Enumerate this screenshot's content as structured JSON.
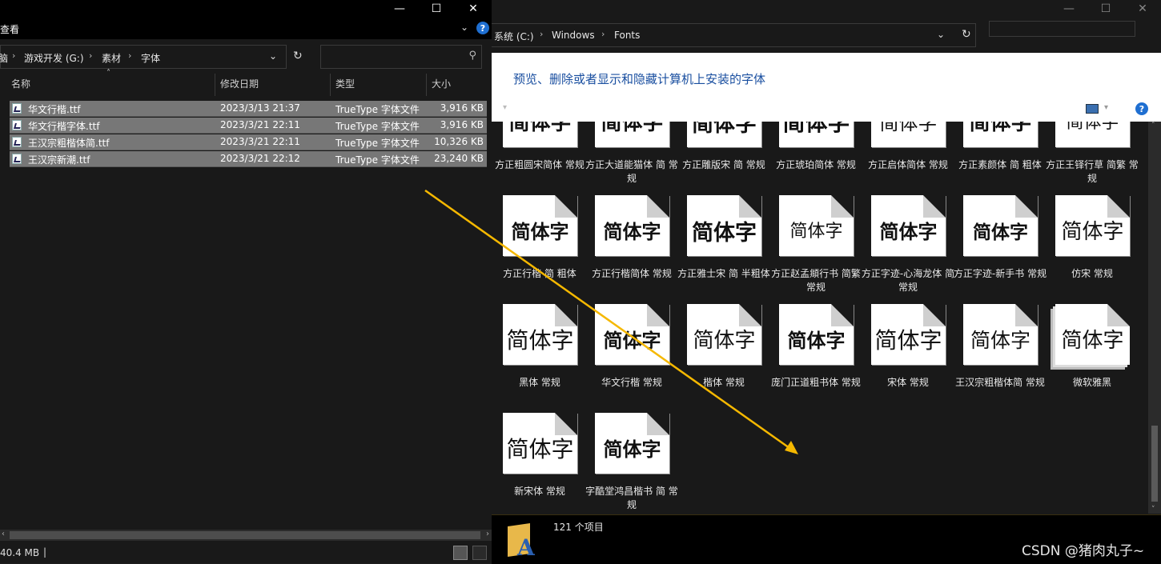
{
  "left_window": {
    "ribbon_label": "查看",
    "address": {
      "crumb0": "脑",
      "crumb1": "游戏开发 (G:)",
      "crumb2": "素材",
      "crumb3": "字体"
    },
    "columns": {
      "name": "名称",
      "date": "修改日期",
      "type": "类型",
      "size": "大小"
    },
    "files": [
      {
        "name": "华文行楷.ttf",
        "date": "2023/3/13 21:37",
        "type": "TrueType 字体文件",
        "size": "3,916 KB"
      },
      {
        "name": "华文行楷字体.ttf",
        "date": "2023/3/21 22:11",
        "type": "TrueType 字体文件",
        "size": "3,916 KB"
      },
      {
        "name": "王汉宗粗楷体简.ttf",
        "date": "2023/3/21 22:11",
        "type": "TrueType 字体文件",
        "size": "10,326 KB"
      },
      {
        "name": "王汉宗新潮.ttf",
        "date": "2023/3/21 22:12",
        "type": "TrueType 字体文件",
        "size": "23,240 KB"
      }
    ],
    "status_size": "40.4 MB"
  },
  "right_window": {
    "address": {
      "crumb1": "系统 (C:)",
      "crumb2": "Windows",
      "crumb3": "Fonts"
    },
    "banner": "预览、删除或者显示和隐藏计算机上安装的字体",
    "preview_text": "简体字",
    "fonts": [
      {
        "name": "方正粗圆宋简体 常规"
      },
      {
        "name": "方正大道能猫体 简 常规"
      },
      {
        "name": "方正雕版宋 简 常规"
      },
      {
        "name": "方正琥珀简体 常规"
      },
      {
        "name": "方正启体简体 常规"
      },
      {
        "name": "方正素颜体 简 粗体"
      },
      {
        "name": "方正王铎行草 简繁 常规"
      },
      {
        "name": "方正行楷 简 粗体"
      },
      {
        "name": "方正行楷简体 常规"
      },
      {
        "name": "方正雅士宋 简 半粗体"
      },
      {
        "name": "方正赵孟頫行书 简繁 常规"
      },
      {
        "name": "方正字迹-心海龙体 简 常规"
      },
      {
        "name": "方正字迹-新手书 常规"
      },
      {
        "name": "仿宋 常规"
      },
      {
        "name": "黑体 常规"
      },
      {
        "name": "华文行楷 常规"
      },
      {
        "name": "楷体 常规"
      },
      {
        "name": "庞门正道粗书体 常规"
      },
      {
        "name": "宋体 常规"
      },
      {
        "name": "王汉宗粗楷体简 常规"
      },
      {
        "name": "微软雅黑"
      },
      {
        "name": "新宋体 常规"
      },
      {
        "name": "字酷堂鸿昌楷书 简 常规"
      }
    ],
    "item_count": "121 个项目"
  },
  "watermark": "CSDN @猪肉丸子~",
  "colors": {
    "accent_arrow": "#f5b800",
    "banner_link": "#1a4fa0",
    "selection": "#777777"
  }
}
